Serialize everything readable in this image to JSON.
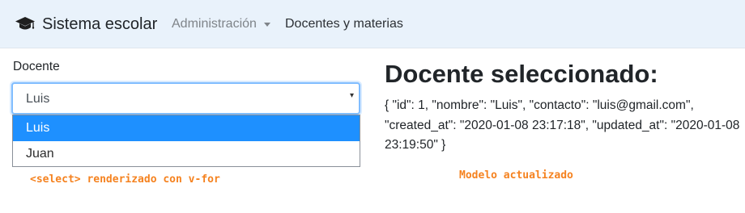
{
  "navbar": {
    "brand_icon": "graduation-cap-icon",
    "brand": "Sistema escolar",
    "admin_label": "Administración",
    "docentes_label": "Docentes y materias"
  },
  "form": {
    "label": "Docente",
    "selected_value": "Luis",
    "options": [
      "Luis",
      "Juan"
    ]
  },
  "main": {
    "heading": "Docente seleccionado:",
    "json_text": "{ \"id\": 1, \"nombre\": \"Luis\", \"contacto\": \"luis@gmail.com\", \"created_at\": \"2020-01-08 23:17:18\", \"updated_at\": \"2020-01-08 23:19:50\" }"
  },
  "annotations": {
    "select_note": "<select> renderizado con v-for",
    "model_note": "Modelo actualizado"
  },
  "colors": {
    "navbar_bg": "#e9f2fb",
    "highlight": "#1e90ff",
    "annotation": "#f5821f",
    "focus_border": "#80bdff"
  }
}
